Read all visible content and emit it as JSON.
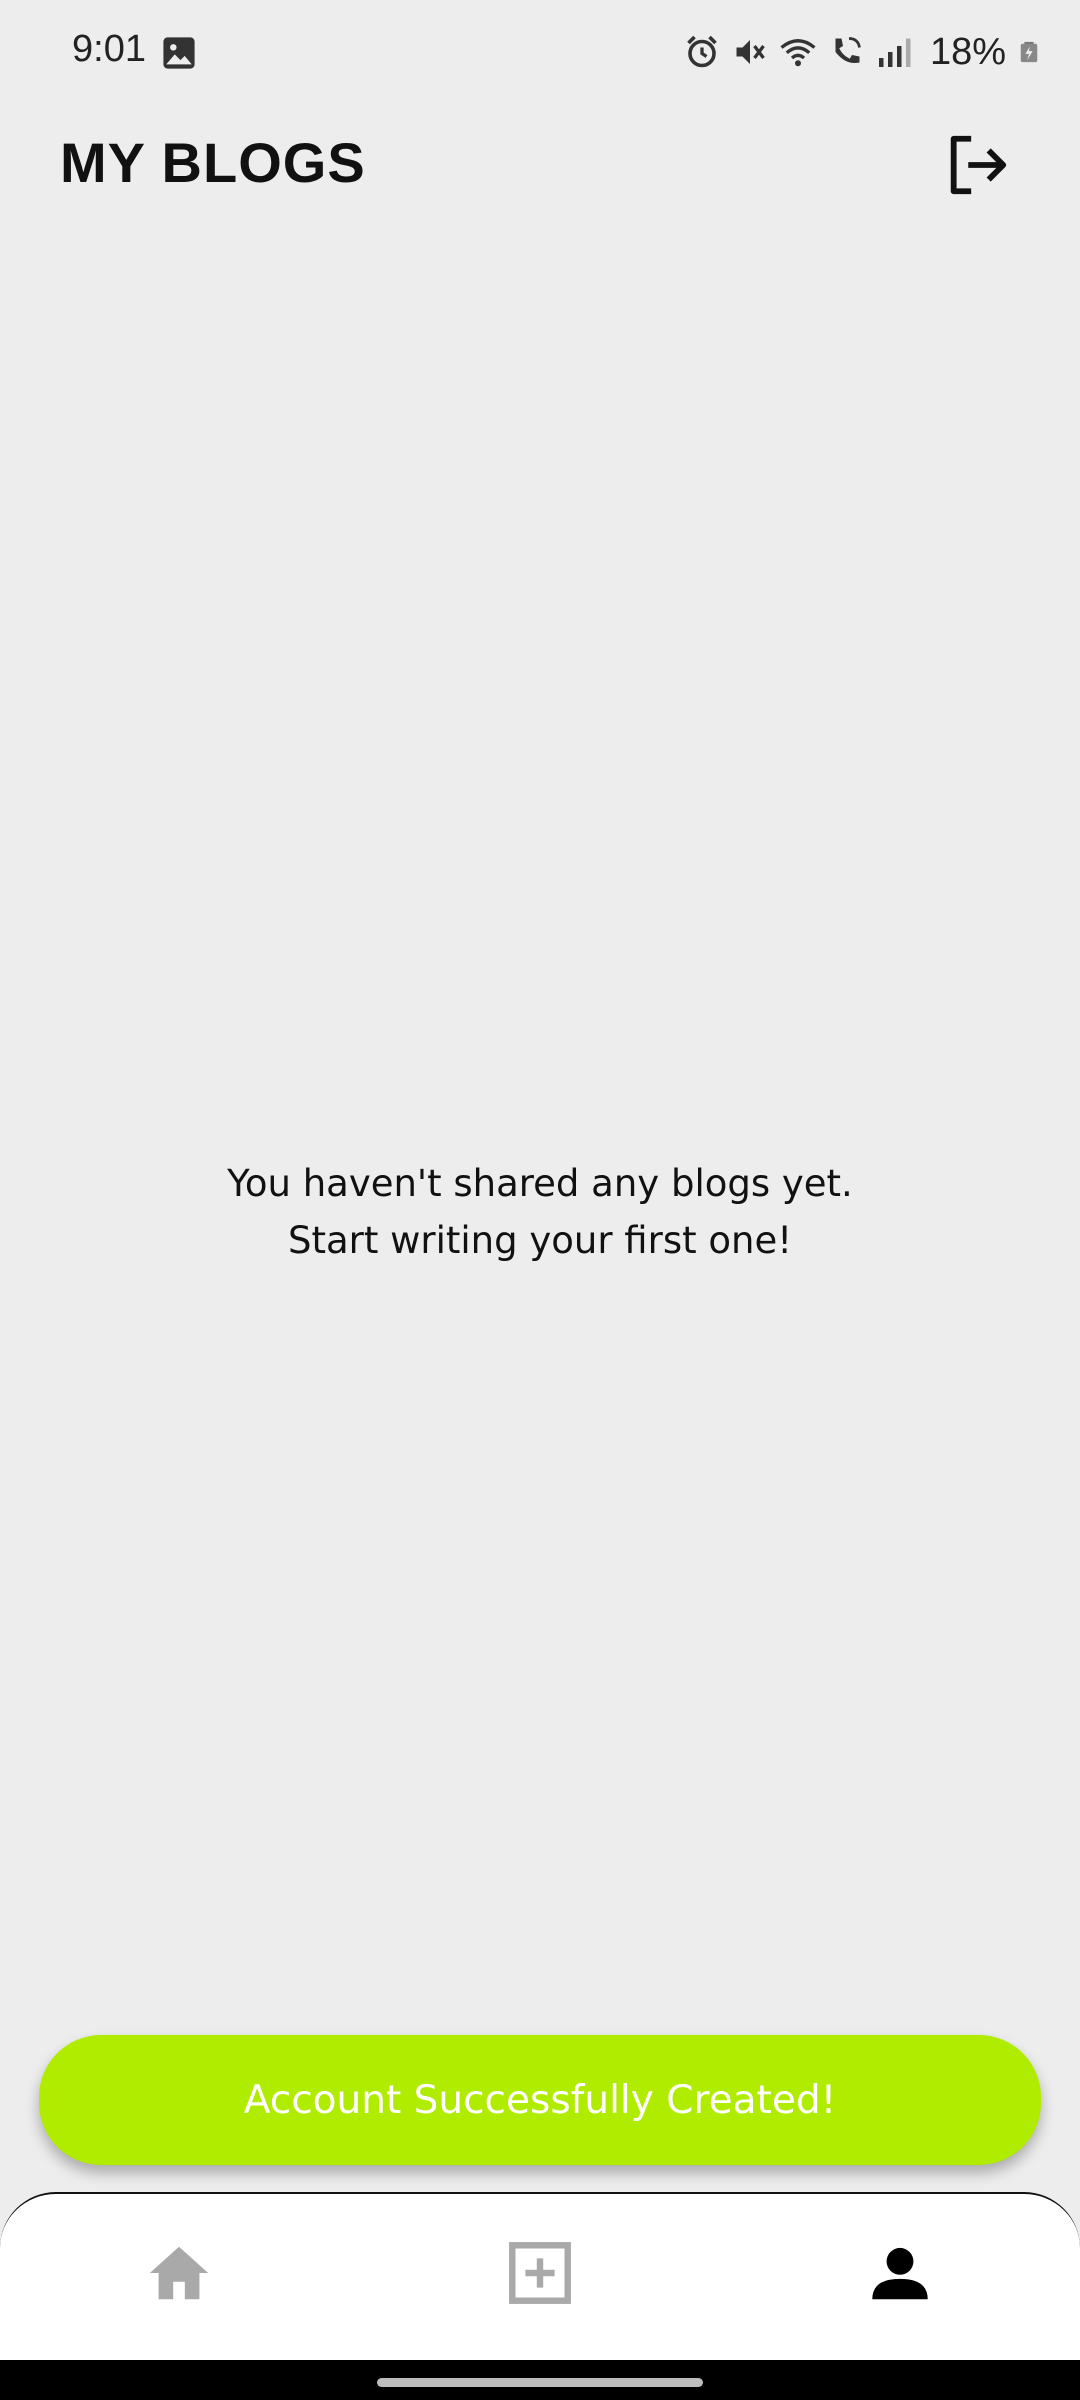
{
  "status_bar": {
    "time": "9:01",
    "battery_percent": "18%",
    "icons": [
      "gallery-icon",
      "alarm-icon",
      "mute-icon",
      "wifi-icon",
      "wifi-call-icon",
      "signal-icon",
      "battery-charging-icon"
    ]
  },
  "header": {
    "title": "MY BLOGS",
    "logout_icon": "logout-icon"
  },
  "empty_state": {
    "line1": "You haven't shared any blogs yet.",
    "line2": "Start writing your first one!"
  },
  "snackbar": {
    "message": "Account Successfully Created!",
    "color": "#b0ec00"
  },
  "bottom_nav": {
    "items": [
      {
        "icon": "home-icon",
        "active": false
      },
      {
        "icon": "add-box-icon",
        "active": false
      },
      {
        "icon": "person-icon",
        "active": true
      }
    ],
    "active_color": "#000000",
    "inactive_color": "#a9a9a9"
  }
}
